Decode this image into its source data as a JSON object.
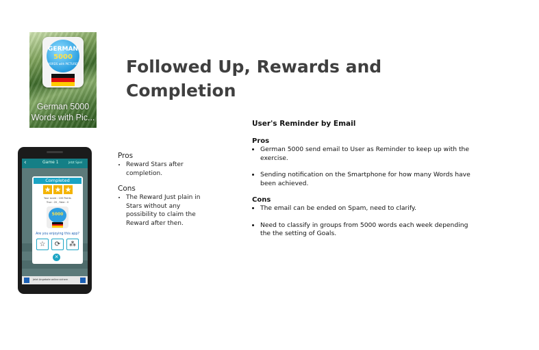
{
  "app_icon": {
    "logo_word": "GERMAN",
    "logo_number": "5000",
    "logo_subtitle": "WORDS with PICTURES",
    "name_line1": "German 5000",
    "name_line2": "Words with Pic...",
    "flag_colors": [
      "#111111",
      "#dd1111",
      "#ffcc00"
    ]
  },
  "slide": {
    "title_line1": "Followed Up, Rewards and",
    "title_line2": "Completion"
  },
  "phone_screen": {
    "topbar_title": "Game 1",
    "topbar_right": "Jetzt Spiel",
    "popup_title": "Completed",
    "score_line1": "Your score : 100 Points",
    "score_line2": "True : 20 , Fake : 0",
    "mini_logo_number": "5000",
    "ask_text": "Are you enjoying this app?",
    "ad_text": "Jetzt Angebote online sichern",
    "accent_color": "#1ba4c4"
  },
  "left_notes": {
    "pros_heading": "Pros",
    "pros": [
      "Reward Stars after completion."
    ],
    "cons_heading": "Cons",
    "cons": [
      "The Reward Just plain in Stars without any possibility to claim the Reward after then."
    ]
  },
  "right_notes": {
    "heading": "User's Reminder by Email",
    "pros_heading": "Pros",
    "pros": [
      "German 5000 send email to User as Reminder to keep up with the exercise.",
      "Sending notification on the Smartphone for how many Words have been achieved."
    ],
    "cons_heading": "Cons",
    "cons": [
      "The email can be ended on Spam, need to clarify.",
      "Need to classify in groups from 5000 words each week depending the the setting of Goals."
    ]
  }
}
